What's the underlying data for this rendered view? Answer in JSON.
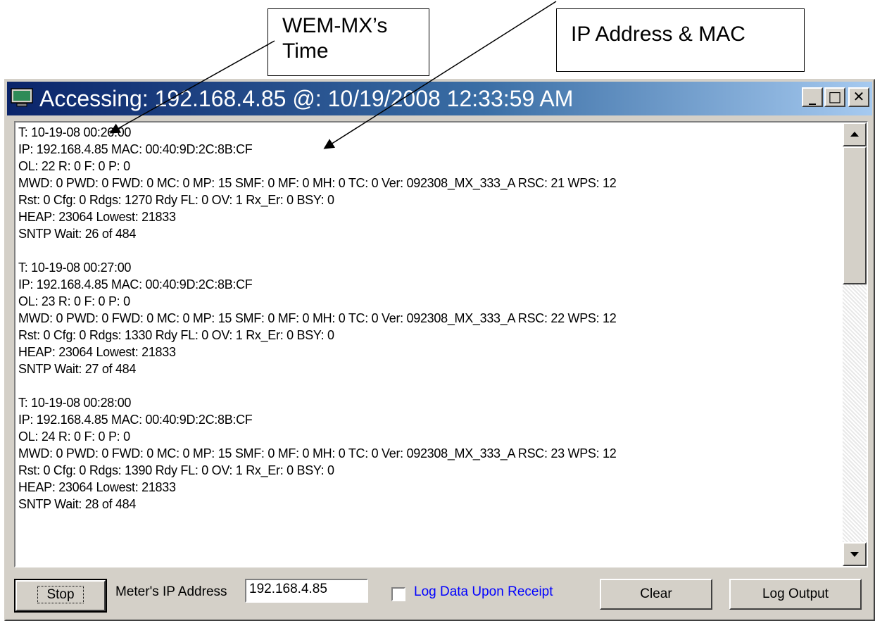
{
  "callouts": {
    "time_line1": "WEM-MX’s",
    "time_line2": "Time",
    "ip_mac": "IP Address & MAC"
  },
  "window": {
    "title": "Accessing: 192.168.4.85 @: 10/19/2008 12:33:59 AM",
    "min_label": "_",
    "max_label": "□",
    "close_label": "✕"
  },
  "log": [
    {
      "t": "T: 10-19-08 00:26:00",
      "ip": "IP: 192.168.4.85 MAC: 00:40:9D:2C:8B:CF",
      "ol": "OL: 22 R:  0 F: 0 P: 0",
      "mwd": "MWD: 0 PWD: 0 FWD: 0 MC: 0 MP: 15 SMF: 0 MF: 0 MH: 0 TC: 0 Ver: 092308_MX_333_A RSC: 21 WPS: 12",
      "rst": "Rst: 0 Cfg: 0 Rdgs: 1270 Rdy FL: 0 OV: 1 Rx_Er: 0 BSY: 0",
      "heap": "HEAP: 23064 Lowest: 21833",
      "sntp": "SNTP Wait: 26 of 484"
    },
    {
      "t": "T: 10-19-08 00:27:00",
      "ip": "IP: 192.168.4.85 MAC: 00:40:9D:2C:8B:CF",
      "ol": "OL: 23 R:  0 F: 0 P: 0",
      "mwd": "MWD: 0 PWD: 0 FWD: 0 MC: 0 MP: 15 SMF: 0 MF: 0 MH: 0 TC: 0 Ver: 092308_MX_333_A RSC: 22 WPS: 12",
      "rst": "Rst: 0 Cfg: 0 Rdgs: 1330 Rdy FL: 0 OV: 1 Rx_Er: 0 BSY: 0",
      "heap": "HEAP: 23064 Lowest: 21833",
      "sntp": "SNTP Wait: 27 of 484"
    },
    {
      "t": "T: 10-19-08 00:28:00",
      "ip": "IP: 192.168.4.85 MAC: 00:40:9D:2C:8B:CF",
      "ol": "OL: 24 R:  0 F: 0 P: 0",
      "mwd": "MWD: 0 PWD: 0 FWD: 0 MC: 0 MP: 15 SMF: 0 MF: 0 MH: 0 TC: 0 Ver: 092308_MX_333_A RSC: 23 WPS: 12",
      "rst": "Rst: 0 Cfg: 0 Rdgs: 1390 Rdy FL: 0 OV: 1 Rx_Er: 0 BSY: 0",
      "heap": "HEAP: 23064 Lowest: 21833",
      "sntp": "SNTP Wait: 28 of 484"
    }
  ],
  "controls": {
    "stop_label": "Stop",
    "ip_label": "Meter's IP Address",
    "ip_value": "192.168.4.85",
    "log_checkbox_label": "Log Data Upon Receipt",
    "log_checkbox_checked": false,
    "clear_label": "Clear",
    "log_output_label": "Log Output"
  },
  "colors": {
    "title_gradient_start": "#0a246a",
    "title_gradient_end": "#a6caf0",
    "checkbox_label": "#0000ff",
    "window_face": "#d4d0c8"
  }
}
